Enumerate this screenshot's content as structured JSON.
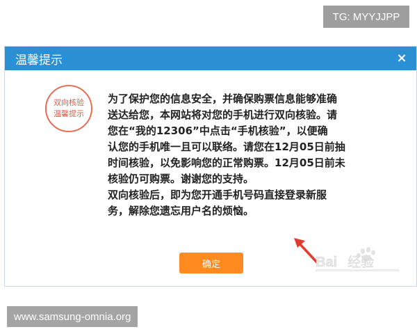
{
  "tag": {
    "text": "TG: MYYJJPP"
  },
  "footer": {
    "text": "www.samsung-omnia.org"
  },
  "dialog": {
    "title": "温馨提示",
    "close_icon": "×",
    "seal": {
      "line1": "双向核验",
      "line2": "温馨提示"
    },
    "message": {
      "lines": [
        "为了保护您的信息安全，并确保购票信息能够准确",
        "送达给您，本网站将对您的手机进行双向核验。请",
        "您在“我的12306”中点击“手机核验”，以便确",
        "认您的手机唯一且可以联络。请您在12月05日前抽",
        "时间核验，以免影响您的正常购票。12月05日前未",
        "核验仍可购票。谢谢您的支持。",
        "双向核验后，即为您开通手机号码直接登录新服",
        "务，解除您遗忘用户名的烦恼。"
      ]
    },
    "confirm_label": "确定"
  },
  "watermark": {
    "text": "Bai经验"
  },
  "colors": {
    "title_bar": "#2b8fd3",
    "confirm_button": "#ff8a1f",
    "seal": "#e05a45",
    "arrow": "#e23b2f"
  }
}
